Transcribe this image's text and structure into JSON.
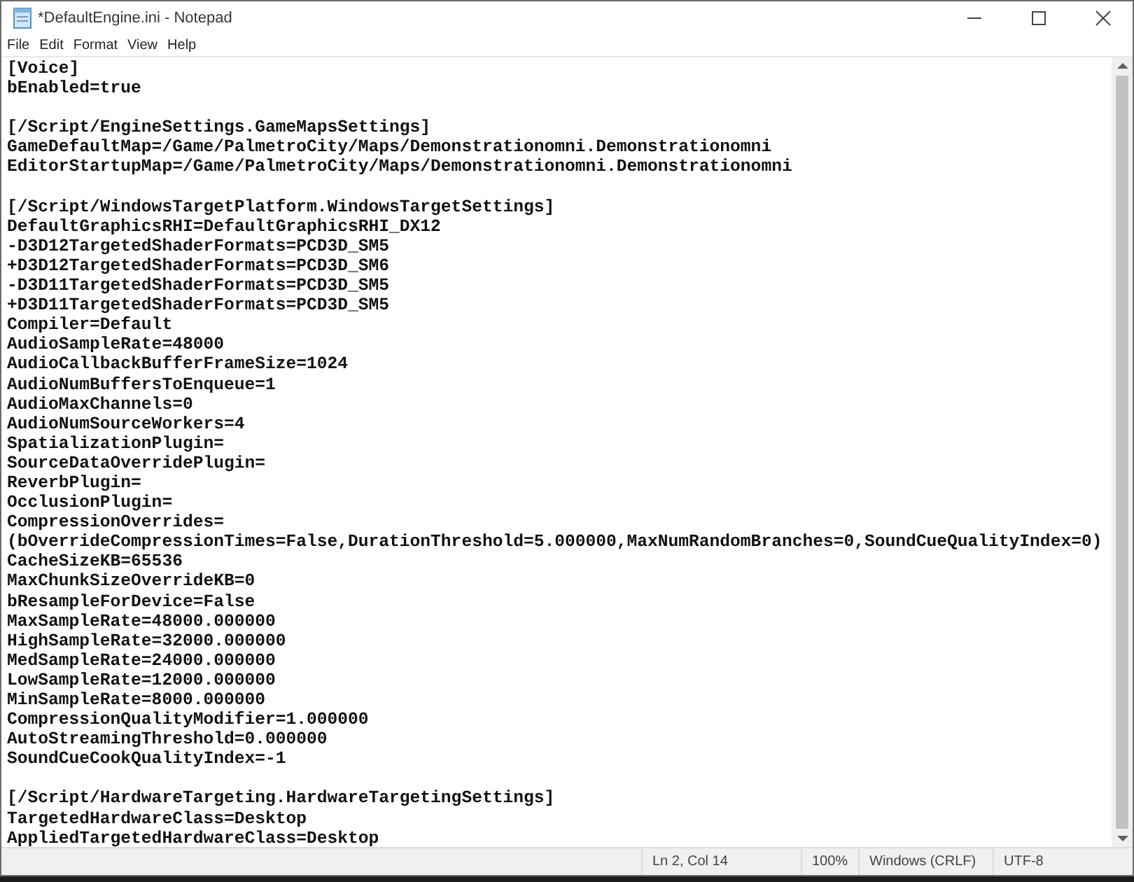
{
  "window": {
    "title": "*DefaultEngine.ini - Notepad"
  },
  "menu": [
    "File",
    "Edit",
    "Format",
    "View",
    "Help"
  ],
  "document": {
    "sections": [
      {
        "lines": [
          "[Voice]",
          "bEnabled=true"
        ]
      },
      {
        "lines": [
          "[/Script/EngineSettings.GameMapsSettings]",
          "GameDefaultMap=/Game/PalmetroCity/Maps/Demonstrationomni.Demonstrationomni",
          "EditorStartupMap=/Game/PalmetroCity/Maps/Demonstrationomni.Demonstrationomni"
        ]
      },
      {
        "lines": [
          "[/Script/WindowsTargetPlatform.WindowsTargetSettings]",
          "DefaultGraphicsRHI=DefaultGraphicsRHI_DX12",
          "-D3D12TargetedShaderFormats=PCD3D_SM5",
          "+D3D12TargetedShaderFormats=PCD3D_SM6",
          "-D3D11TargetedShaderFormats=PCD3D_SM5",
          "+D3D11TargetedShaderFormats=PCD3D_SM5",
          "Compiler=Default",
          "AudioSampleRate=48000",
          "AudioCallbackBufferFrameSize=1024",
          "AudioNumBuffersToEnqueue=1",
          "AudioMaxChannels=0",
          "AudioNumSourceWorkers=4",
          "SpatializationPlugin=",
          "SourceDataOverridePlugin=",
          "ReverbPlugin=",
          "OcclusionPlugin=",
          "CompressionOverrides=",
          "(bOverrideCompressionTimes=False,DurationThreshold=5.000000,MaxNumRandomBranches=0,SoundCueQualityIndex=0)",
          "CacheSizeKB=65536",
          "MaxChunkSizeOverrideKB=0",
          "bResampleForDevice=False",
          "MaxSampleRate=48000.000000",
          "HighSampleRate=32000.000000",
          "MedSampleRate=24000.000000",
          "LowSampleRate=12000.000000",
          "MinSampleRate=8000.000000",
          "CompressionQualityModifier=1.000000",
          "AutoStreamingThreshold=0.000000",
          "SoundCueCookQualityIndex=-1"
        ]
      },
      {
        "lines": [
          "[/Script/HardwareTargeting.HardwareTargetingSettings]",
          "TargetedHardwareClass=Desktop",
          "AppliedTargetedHardwareClass=Desktop"
        ]
      }
    ]
  },
  "status_bar": [
    "Ln 2, Col 14",
    "100%",
    "Windows (CRLF)",
    "UTF-8"
  ]
}
